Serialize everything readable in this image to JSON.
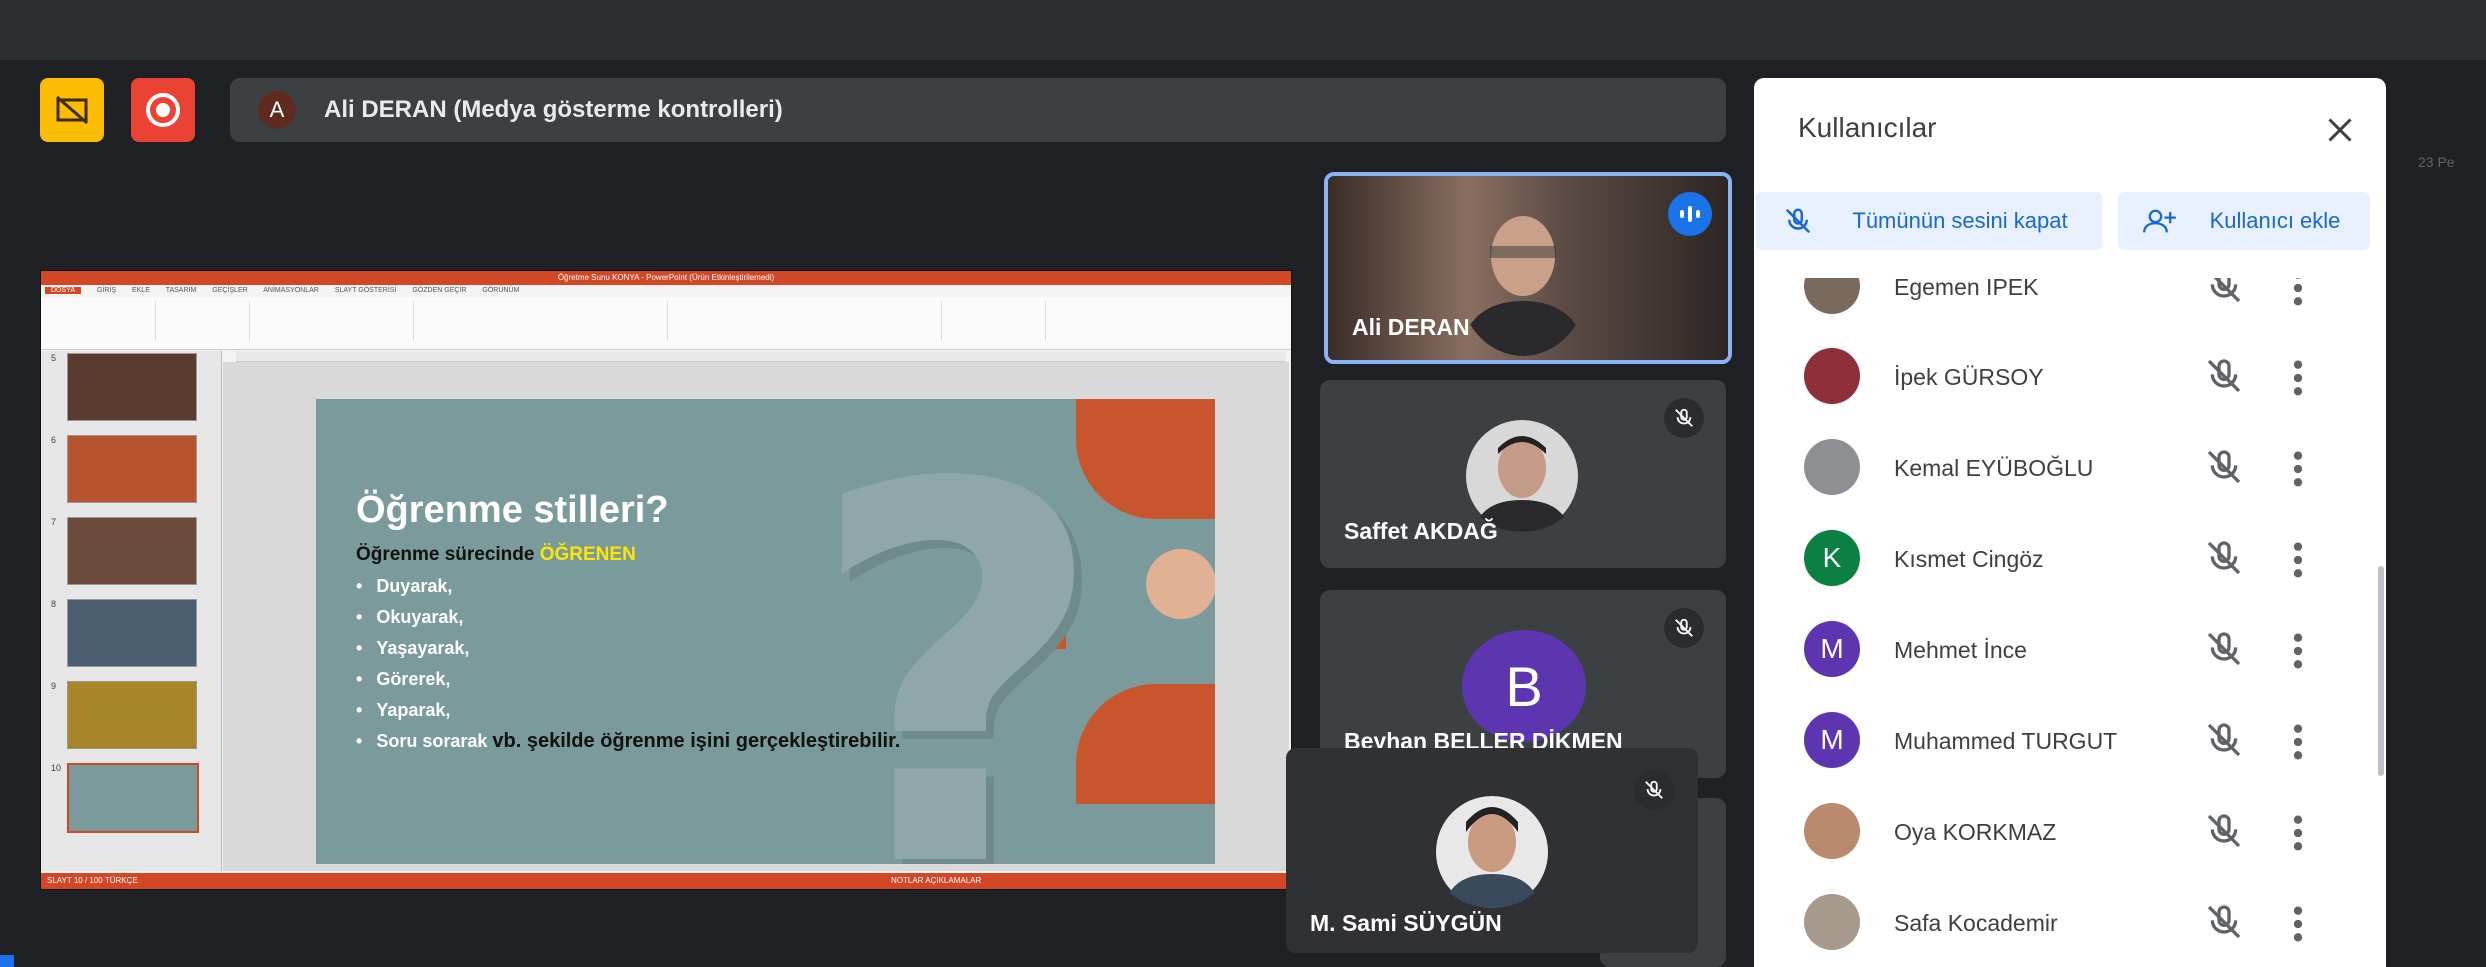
{
  "toolbar": {
    "presentation_toggle_icon": "presentation-off-icon",
    "record_icon": "record-icon"
  },
  "presenter_bar": {
    "avatar_initial": "A",
    "label": "Ali DERAN (Medya gösterme kontrolleri)"
  },
  "shared_slide": {
    "title": "Öğrenme stilleri?",
    "subtitle_prefix": "Öğrenme sürecinde ",
    "subtitle_highlight": "ÖĞRENEN",
    "bullets": [
      "Duyarak,",
      "Okuyarak,",
      "Yaşayarak,",
      "Görerek,",
      "Yaparak,"
    ],
    "last_bullet_prefix": "Soru sorarak ",
    "last_bullet_bold": "vb. şekilde öğrenme işini gerçekleştirebilir."
  },
  "ppt": {
    "window_title": "Öğretme Sunu KONYA - PowerPoint (Ürün Etkinleştirilemedi)",
    "tabs": [
      "DOSYA",
      "GİRİŞ",
      "EKLE",
      "TASARIM",
      "GEÇİŞLER",
      "ANİMASYONLAR",
      "SLAYT GÖSTERİSİ",
      "GÖZDEN GEÇİR",
      "GÖRÜNÜM"
    ],
    "thumb_numbers": [
      "5",
      "6",
      "7",
      "8",
      "9",
      "10"
    ],
    "status_left": "SLAYT 10 / 100     TÜRKÇE",
    "status_right": "NOTLAR   AÇIKLAMALAR"
  },
  "tiles": [
    {
      "name": "Ali DERAN",
      "speaking": true
    },
    {
      "name": "Saffet AKDAĞ",
      "muted": true
    },
    {
      "name": "Beyhan BELLER DİKMEN",
      "initial": "B",
      "color": "#5e35b1",
      "muted": true
    },
    {
      "name": "M. Sami SÜYGÜN",
      "muted": true
    }
  ],
  "panel": {
    "title": "Kullanıcılar",
    "mute_all_label": "Tümünün sesini kapat",
    "add_user_label": "Kullanıcı ekle",
    "participants": [
      {
        "name": "Egemen İPEK",
        "type": "photo",
        "color": "#7a6a5e"
      },
      {
        "name": "İpek GÜRSOY",
        "type": "photo",
        "color": "#8e2f3a"
      },
      {
        "name": "Kemal EYÜBOĞLU",
        "type": "photo",
        "color": "#8d8f93"
      },
      {
        "name": "Kısmet Cingöz",
        "type": "initial",
        "initial": "K",
        "color": "#0b8043"
      },
      {
        "name": "Mehmet İnce",
        "type": "initial",
        "initial": "M",
        "color": "#5e35b1"
      },
      {
        "name": "Muhammed TURGUT",
        "type": "initial",
        "initial": "M",
        "color": "#5e35b1"
      },
      {
        "name": "Oya KORKMAZ",
        "type": "photo",
        "color": "#b98a6e"
      },
      {
        "name": "Safa Kocademir",
        "type": "photo",
        "color": "#a79a8c"
      }
    ]
  },
  "edge_text": "23 Pe"
}
